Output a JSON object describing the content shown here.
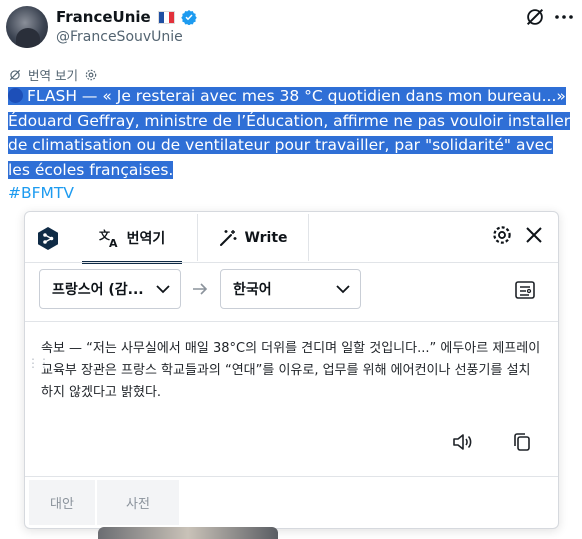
{
  "tweet": {
    "author_name": "FranceUnie",
    "author_flag": "🇫🇷",
    "author_handle": "@FranceSouvUnie",
    "translate_label": "번역 보기",
    "text_line1": "FLASH — « Je resterai avec mes 38 °C quotidien dans mon bureau...»",
    "text_rest": "Édouard Geffray, ministre de l’Éducation, affirme ne pas vouloir installer de climatisation ou de ventilateur pour travailler, par \"solidarité\" avec les écoles françaises.",
    "hashtag": "#BFMTV",
    "colors": {
      "highlight": "#2f6fd6",
      "link": "#1d9bf0",
      "verified": "#1d9bf0"
    }
  },
  "translator": {
    "tabs": [
      {
        "label": "번역기",
        "icon": "translate-icon",
        "active": true
      },
      {
        "label": "Write",
        "icon": "magic-wand-icon",
        "active": false
      }
    ],
    "source_lang": "프랑스어 (감...",
    "target_lang": "한국어",
    "result": "속보 — “저는 사무실에서 매일 38°C의 더위를 견디며 일할 것입니다...” 에두아르 제프레이 교육부 장관은 프랑스 학교들과의 “연대”를 이유로, 업무를 위해 에어컨이나 선풍기를 설치하지 않겠다고 밝혔다.",
    "alt_button": "대안",
    "dict_button": "사전",
    "accent": "#0f2b46"
  }
}
